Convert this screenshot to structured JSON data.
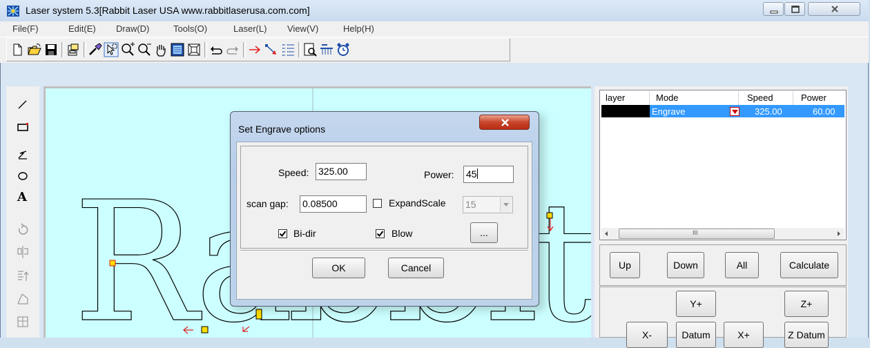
{
  "window": {
    "title": "Laser system 5.3[Rabbit Laser USA www.rabbitlaserusa.com.com]"
  },
  "menu": [
    "File(F)",
    "Edit(E)",
    "Draw(D)",
    "Tools(O)",
    "Laser(L)",
    "View(V)",
    "Help(H)"
  ],
  "toolbar": [
    "new-icon",
    "open-icon",
    "save-icon",
    "import-icon",
    "select-brush-icon",
    "pick-icon",
    "zoom-in-icon",
    "zoom-out-icon",
    "pan-hand-icon",
    "page-view-icon",
    "zoom-fit-icon",
    "undo-icon",
    "redo-icon",
    "direction-icon",
    "start-point-icon",
    "sort-icon",
    "preview-icon",
    "simulate-icon",
    "timer-icon"
  ],
  "left_tools": [
    "line-icon",
    "rectangle-icon",
    "polyline-icon",
    "ellipse-icon",
    "text-icon",
    "rotate-icon",
    "mirror-icon",
    "align-icon",
    "node-edit-icon",
    "array-icon"
  ],
  "layers": {
    "headers": [
      "layer",
      "Mode",
      "Speed",
      "Power"
    ],
    "rows": [
      {
        "color": "#000000",
        "mode": "Engrave",
        "speed": "325.00",
        "power": "60.00"
      }
    ],
    "scroll_glyph": "III"
  },
  "panel_buttons": {
    "up": "Up",
    "down": "Down",
    "all": "All",
    "calculate": "Calculate"
  },
  "jog_buttons": {
    "y_plus": "Y+",
    "z_plus": "Z+",
    "x_minus": "X-",
    "datum": "Datum",
    "x_plus": "X+",
    "z_datum": "Z Datum"
  },
  "dialog": {
    "title": "Set Engrave options",
    "speed_label": "Speed:",
    "speed_value": "325.00",
    "power_label": "Power:",
    "power_value": "45",
    "scan_gap_label": "scan gap:",
    "scan_gap_value": "0.08500",
    "expand_scale_label": "ExpandScale",
    "expand_scale_checked": false,
    "expand_scale_value": "15",
    "bidir_label": "Bi-dir",
    "bidir_checked": true,
    "blow_label": "Blow",
    "blow_checked": true,
    "more_label": "...",
    "ok_label": "OK",
    "cancel_label": "Cancel"
  },
  "canvas": {
    "text": "Rabbit"
  },
  "colors": {
    "canvas_bg": "#ccffff",
    "selection": "#3399ff",
    "node_marker": "#ffdd00",
    "path_arrow": "#ff0000"
  }
}
